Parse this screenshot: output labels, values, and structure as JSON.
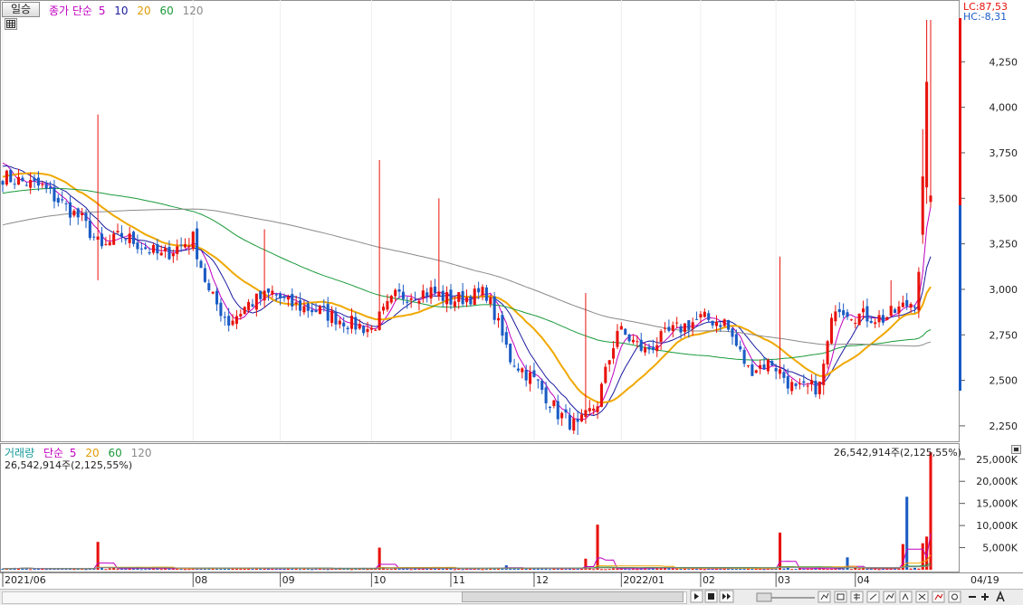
{
  "price_header": {
    "period_button": "일승",
    "ma_label": "종가 단순",
    "ma_periods": [
      "5",
      "10",
      "20",
      "60",
      "120"
    ],
    "lc_text": "LC:87,53",
    "hc_text": "HC:-8,31"
  },
  "volume_header": {
    "title": "거래량",
    "ma_label": "단순",
    "ma_periods": [
      "5",
      "20",
      "60",
      "120"
    ],
    "last_volume_text": "26,542,914주(2,125,55%)"
  },
  "colors": {
    "up": "#e8120c",
    "down": "#1a5bc4",
    "ma5": "#c000c0",
    "ma10": "#1a1aa0",
    "ma20": "#f0a800",
    "ma60": "#1a9a3a",
    "ma120": "#8a8a8a"
  },
  "chart_data": [
    {
      "type": "candlestick",
      "name": "price",
      "y_ticks": [
        "4,250",
        "4,000",
        "3,750",
        "3,500",
        "3,250",
        "3,000",
        "2,750",
        "2,500",
        "2,250"
      ],
      "y_tick_values": [
        4250,
        4000,
        3750,
        3500,
        3250,
        3000,
        2750,
        2500,
        2250
      ],
      "ylim": [
        2180,
        4480
      ],
      "x_ticks": [
        "2021/06",
        "08",
        "09",
        "10",
        "11",
        "12",
        "2022/01",
        "02",
        "03",
        "04"
      ],
      "x_tick_days": [
        0,
        48,
        70,
        93,
        113,
        134,
        156,
        176,
        195,
        215
      ],
      "last_day_label": "04/19",
      "last_close": 3515,
      "key_points": [
        {
          "label": "2021/06",
          "close": 3620
        },
        {
          "label": "08 start",
          "close": 3280
        },
        {
          "label": "09",
          "close": 2900
        },
        {
          "label": "10",
          "close": 2810
        },
        {
          "label": "11",
          "close": 2940
        },
        {
          "label": "12 low",
          "close": 2240
        },
        {
          "label": "2022/01",
          "close": 2840
        },
        {
          "label": "02",
          "close": 2560
        },
        {
          "label": "03",
          "close": 2860
        },
        {
          "label": "04",
          "close": 2880
        },
        {
          "label": "04/19",
          "close": 3515
        }
      ],
      "series": [
        {
          "name": "5"
        },
        {
          "name": "10"
        },
        {
          "name": "20"
        },
        {
          "name": "60"
        },
        {
          "name": "120"
        }
      ]
    },
    {
      "type": "bar",
      "name": "volume",
      "y_ticks": [
        "25,000K",
        "20,000K",
        "15,000K",
        "10,000K",
        "5,000K"
      ],
      "y_tick_values": [
        25000,
        20000,
        15000,
        10000,
        5000
      ],
      "ylim": [
        0,
        27000
      ],
      "unit": "K",
      "last_value": 26542.914,
      "spikes": [
        {
          "day": 24,
          "value": 6300
        },
        {
          "day": 95,
          "value": 5000
        },
        {
          "day": 127,
          "value": 1000
        },
        {
          "day": 147,
          "value": 2500
        },
        {
          "day": 150,
          "value": 10200
        },
        {
          "day": 167,
          "value": 500
        },
        {
          "day": 196,
          "value": 8400
        },
        {
          "day": 213,
          "value": 2800
        },
        {
          "day": 227,
          "value": 5800
        },
        {
          "day": 228,
          "value": 16500
        },
        {
          "day": 232,
          "value": 6000
        },
        {
          "day": 233,
          "value": 7500
        },
        {
          "day": 234,
          "value": 26542
        }
      ]
    }
  ]
}
